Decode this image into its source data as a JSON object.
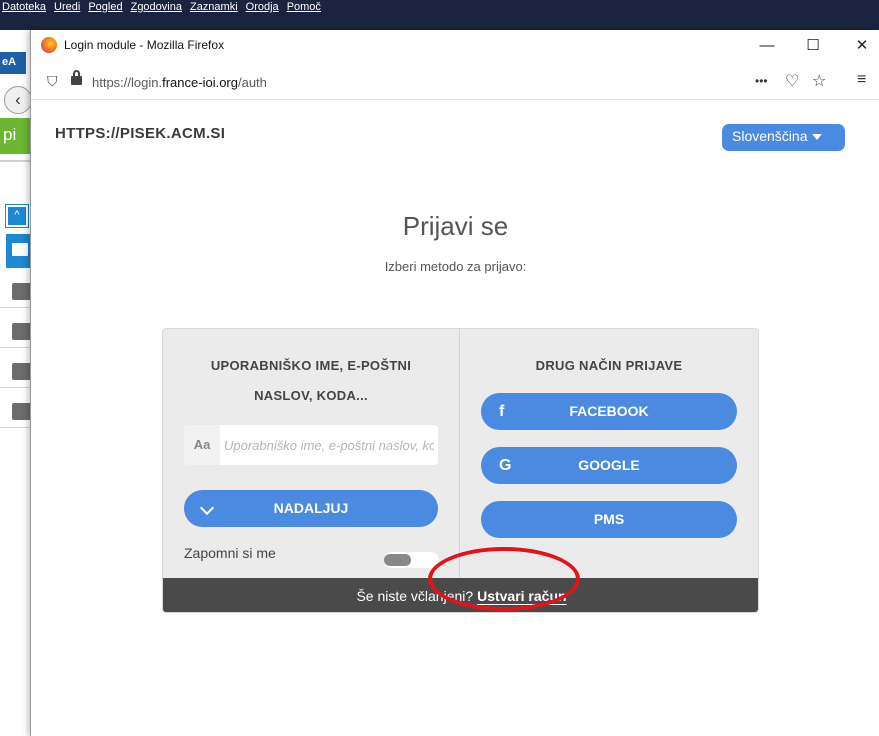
{
  "bg_window": {
    "menu": [
      "Datoteka",
      "Uredi",
      "Pogled",
      "Zgodovina",
      "Zaznamki",
      "Orodja",
      "Pomoč"
    ],
    "ea_label": "eA",
    "green_label": "pi"
  },
  "window": {
    "title": "Login module - Mozilla Firefox",
    "minimize": "—",
    "maximize": "☐",
    "close": "✕"
  },
  "url": {
    "prefix": "https://login.",
    "domain": "france-ioi.org",
    "path": "/auth",
    "more": "•••",
    "pocket": "♡",
    "star": "☆",
    "menu": "≡"
  },
  "page": {
    "site": "HTTPS://PISEK.ACM.SI",
    "language": "Slovenščina",
    "heading": "Prijavi se",
    "subheading": "Izberi metodo za prijavo:",
    "left_title": "UPORABNIŠKO IME, E-POŠTNI NASLOV, KODA...",
    "input_prefix": "Aa",
    "input_placeholder": "Uporabniško ime, e-poštni naslov, koda...",
    "continue_label": "NADALJUJ",
    "remember_label": "Zapomni si me",
    "remember_on": false,
    "right_title": "DRUG NAČIN PRIJAVE",
    "facebook_label": "FACEBOOK",
    "facebook_icon": "f",
    "google_label": "GOOGLE",
    "google_icon": "G",
    "pms_label": "PMS",
    "footer_text": "Še niste včlanjeni? ",
    "footer_link": "Ustvari račun"
  },
  "colors": {
    "accent": "#4a8ae0",
    "footer": "#4a4a4a",
    "annotation": "#e0141a"
  }
}
